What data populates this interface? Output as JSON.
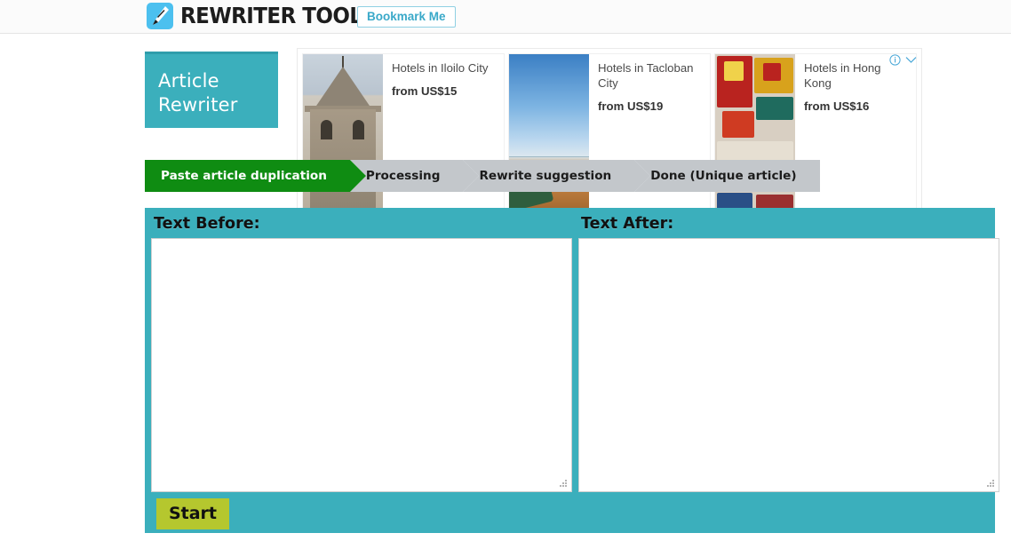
{
  "header": {
    "brand_name": "REWRITER TOOLS",
    "logo_icon": "pen-nib-icon",
    "bookmark_label": "Bookmark Me"
  },
  "panel": {
    "title_line1": "Article",
    "title_line2": "Rewriter"
  },
  "steps": [
    {
      "label": "Paste article duplication",
      "state": "active"
    },
    {
      "label": "Processing",
      "state": "inactive"
    },
    {
      "label": "Rewrite suggestion",
      "state": "inactive"
    },
    {
      "label": "Done (Unique article)",
      "state": "inactive"
    }
  ],
  "editor": {
    "before_label": "Text Before:",
    "before_value": "",
    "before_placeholder": "",
    "after_label": "Text After:",
    "after_value": "",
    "after_placeholder": "",
    "start_label": "Start"
  },
  "ads": {
    "adchoices_info_icon": "info-circle-icon",
    "adchoices_chevron_icon": "chevron-down-icon",
    "units": [
      {
        "title": "Hotels in Iloilo City",
        "price": "from US$15",
        "image": "stone-bell-tower-photo"
      },
      {
        "title": "Hotels in Tacloban City",
        "price": "from US$19",
        "image": "beach-sky-photo"
      },
      {
        "title": "Hotels in Hong Kong",
        "price": "from US$16",
        "image": "hong-kong-street-signs-photo"
      }
    ]
  },
  "colors": {
    "teal": "#3bafbc",
    "step_active": "#0f8c12",
    "step_inactive": "#c3c7cb",
    "start_button": "#b5c72e",
    "brand_blue": "#4cc0ef",
    "bookmark_border": "#8fd0e3"
  }
}
